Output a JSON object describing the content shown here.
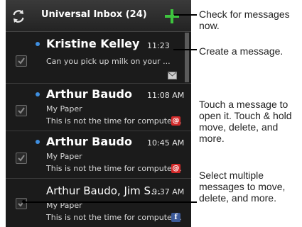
{
  "header": {
    "title": "Universal Inbox (24)"
  },
  "icons": {
    "sync": "sync-icon",
    "compose": "compose-plus-icon",
    "check": "checkmark-icon",
    "attachment": "envelope-icon",
    "email": "at-sign-icon",
    "facebook": "facebook-icon"
  },
  "colors": {
    "unread_dot": "#3f8fe0",
    "compose_plus": "#3ec43e",
    "email_badge": "#d42a2a",
    "facebook_badge": "#3b5998"
  },
  "messages": [
    {
      "sender": "Kristine Kelley",
      "time": "11:23",
      "preview": "Can you pick up milk on your ...",
      "unread": true,
      "badge": "attachment"
    },
    {
      "sender": "Arthur Baudo",
      "time": "11:08 AM",
      "subject": "My Paper",
      "preview": "This is not the time for computer...",
      "unread": true,
      "badge": "@"
    },
    {
      "sender": "Arthur Baudo",
      "time": "10:45 AM",
      "subject": "My Paper",
      "preview": "This is not the time for computer...",
      "unread": true,
      "badge": "@"
    },
    {
      "sender": "Arthur Baudo, Jim S...",
      "time": "9:37 AM",
      "subject": "My Paper",
      "preview": "This is not the time for computer...",
      "unread": false,
      "badge": "f"
    }
  ],
  "annotations": {
    "check": "Check for messages now.",
    "create": "Create a message.",
    "touch": "Touch a message to open it. Touch & hold move, delete, and more.",
    "select": "Select multiple messages to move, delete, and more."
  }
}
